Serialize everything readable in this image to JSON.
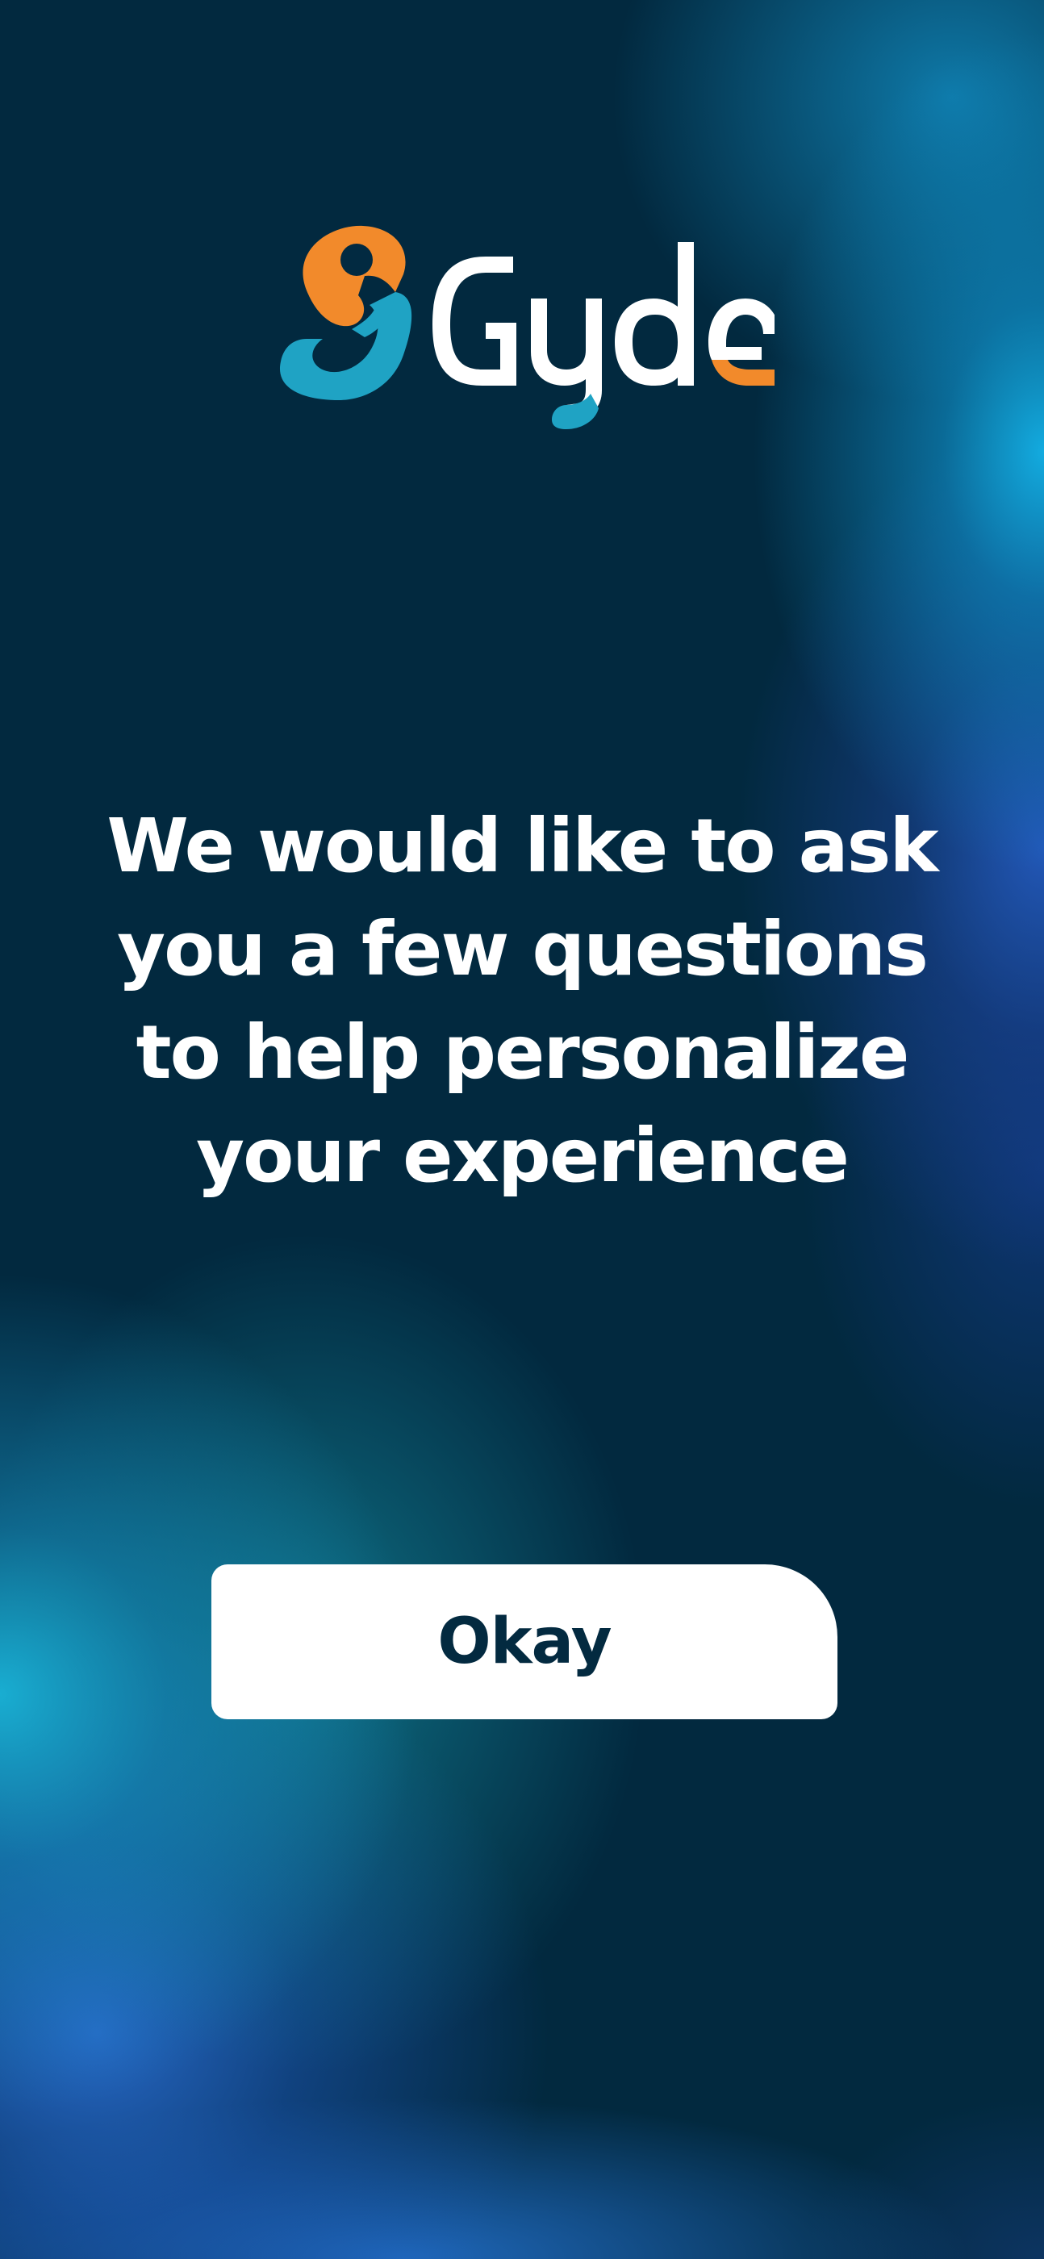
{
  "brand": {
    "logo_text": "Gyde",
    "colors": {
      "orange": "#F28A2B",
      "teal": "#1FA3C4",
      "white": "#FFFFFF",
      "background": "#02293F"
    }
  },
  "main": {
    "headline_lines": [
      "We would like to ask",
      "you a few questions",
      "to help personalize",
      "your experience"
    ]
  },
  "actions": {
    "okay_label": "Okay"
  }
}
